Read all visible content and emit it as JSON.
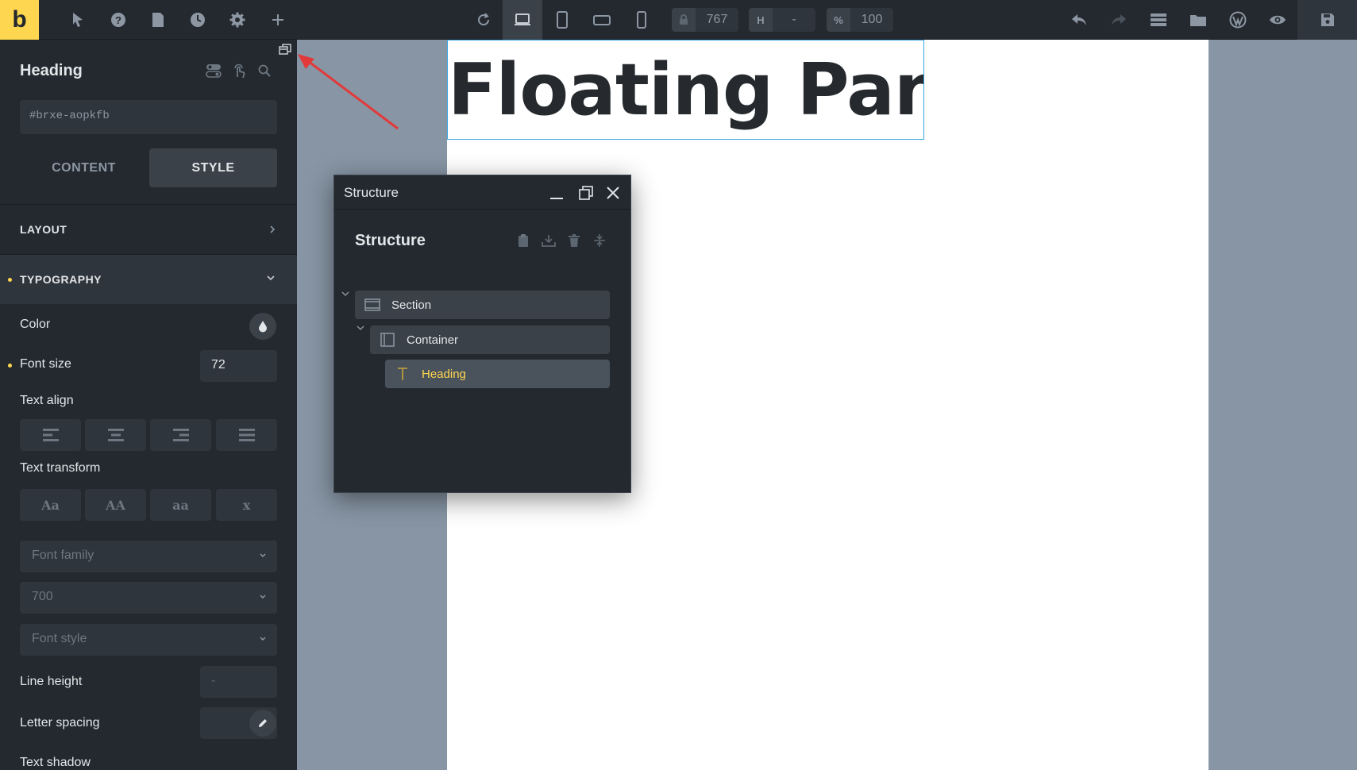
{
  "toolbar": {
    "logo": "b",
    "width_prefix": "",
    "width_value": "767",
    "height_prefix": "H",
    "height_value": "-",
    "zoom_prefix": "%",
    "zoom_value": "100",
    "left_icons": [
      "pointer-icon",
      "help-icon",
      "pages-icon",
      "history-icon",
      "settings-icon",
      "add-icon"
    ],
    "center_icons": [
      "refresh-icon",
      "desktop-icon",
      "tablet-portrait-icon",
      "tablet-landscape-icon",
      "mobile-icon"
    ],
    "right_icons": [
      "undo-icon",
      "redo-icon",
      "structure-icon",
      "templates-icon",
      "wordpress-icon",
      "preview-icon",
      "save-icon"
    ]
  },
  "panel": {
    "title": "Heading",
    "element_id": "#brxe-aopkfb",
    "tabs": {
      "content": "CONTENT",
      "style": "STYLE",
      "active": "STYLE"
    },
    "groups": {
      "layout": "LAYOUT",
      "typography": "TYPOGRAPHY"
    },
    "controls": {
      "color": "Color",
      "font_size_label": "Font size",
      "font_size_value": "72",
      "text_align": "Text align",
      "text_transform": "Text transform",
      "transform_options": [
        "Aa",
        "AA",
        "aa",
        "x"
      ],
      "font_family_placeholder": "Font family",
      "font_weight_value": "700",
      "font_style_placeholder": "Font style",
      "line_height_label": "Line height",
      "line_height_placeholder": "-",
      "letter_spacing_label": "Letter spacing",
      "text_shadow_label": "Text shadow"
    }
  },
  "canvas": {
    "heading_text": "Floating Panel"
  },
  "structure_window": {
    "window_title": "Structure",
    "panel_heading": "Structure",
    "tree": [
      {
        "label": "Section",
        "icon": "section-icon",
        "level": 0,
        "expanded": true
      },
      {
        "label": "Container",
        "icon": "container-icon",
        "level": 1,
        "expanded": true
      },
      {
        "label": "Heading",
        "icon": "heading-icon",
        "level": 2,
        "selected": true
      }
    ]
  },
  "colors": {
    "accent": "#ffd64f",
    "panel_bg": "#24292f",
    "canvas_bg": "#8795a4",
    "selection_outline": "#3ba6de",
    "annotation_arrow": "#e23a3a"
  }
}
